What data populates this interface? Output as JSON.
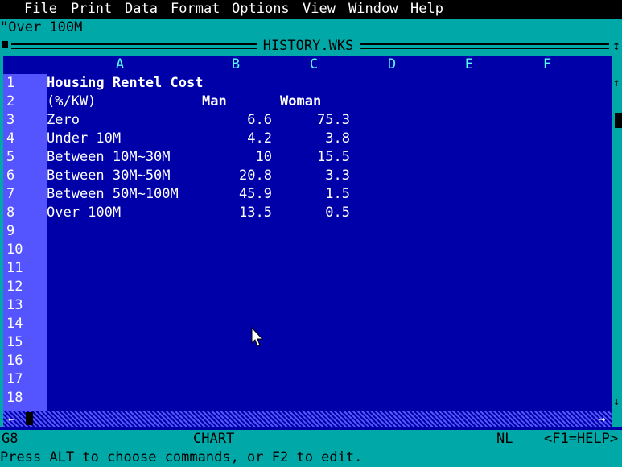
{
  "menubar": {
    "items": [
      {
        "hot": "F",
        "rest": "ile"
      },
      {
        "hot": "P",
        "rest": "rint"
      },
      {
        "hot": "D",
        "rest": "ata"
      },
      {
        "hot": "",
        "rest": "Format"
      },
      {
        "hot": "O",
        "rest": "ptions"
      },
      {
        "hot": "V",
        "rest": "iew"
      },
      {
        "hot": "W",
        "rest": "indow"
      },
      {
        "hot": "H",
        "rest": "elp"
      }
    ]
  },
  "editline": {
    "value": "\"Over 100M"
  },
  "window": {
    "title": "HISTORY.WKS"
  },
  "columns": [
    "A",
    "B",
    "C",
    "D",
    "E",
    "F"
  ],
  "rows": [
    "1",
    "2",
    "3",
    "4",
    "5",
    "6",
    "7",
    "8",
    "9",
    "10",
    "11",
    "12",
    "13",
    "14",
    "15",
    "16",
    "17",
    "18"
  ],
  "sheet": {
    "title": "Housing Rentel Cost",
    "unit": "(%/KW)",
    "header_b": "Man",
    "header_c": "Woman",
    "data": [
      {
        "label": "Zero",
        "man": "6.6",
        "woman": "75.3"
      },
      {
        "label": "Under 10M",
        "man": "4.2",
        "woman": "3.8"
      },
      {
        "label": "Between 10M~30M",
        "man": "10",
        "woman": "15.5"
      },
      {
        "label": "Between 30M~50M",
        "man": "20.8",
        "woman": "3.3"
      },
      {
        "label": "Between 50M~100M",
        "man": "45.9",
        "woman": "1.5"
      },
      {
        "label": "Over 100M",
        "man": "13.5",
        "woman": "0.5"
      }
    ]
  },
  "status": {
    "cell_ref": "G8",
    "mode": "CHART",
    "lock": "NL",
    "help": "<F1=HELP>"
  },
  "helpline": {
    "text": "Press ALT to choose commands, or F2 to edit."
  },
  "icons": {
    "close": "close-box-icon",
    "resize": "updown-arrow-icon",
    "scroll_up": "up-arrow-icon",
    "scroll_down": "down-arrow-icon",
    "scroll_left": "left-arrow-icon",
    "scroll_right": "right-arrow-icon",
    "pointer": "mouse-pointer-icon"
  },
  "colors": {
    "background": "#0000a8",
    "chrome": "#00a8a8",
    "row_header": "#5555ff",
    "column_header_text": "#55ffff"
  }
}
